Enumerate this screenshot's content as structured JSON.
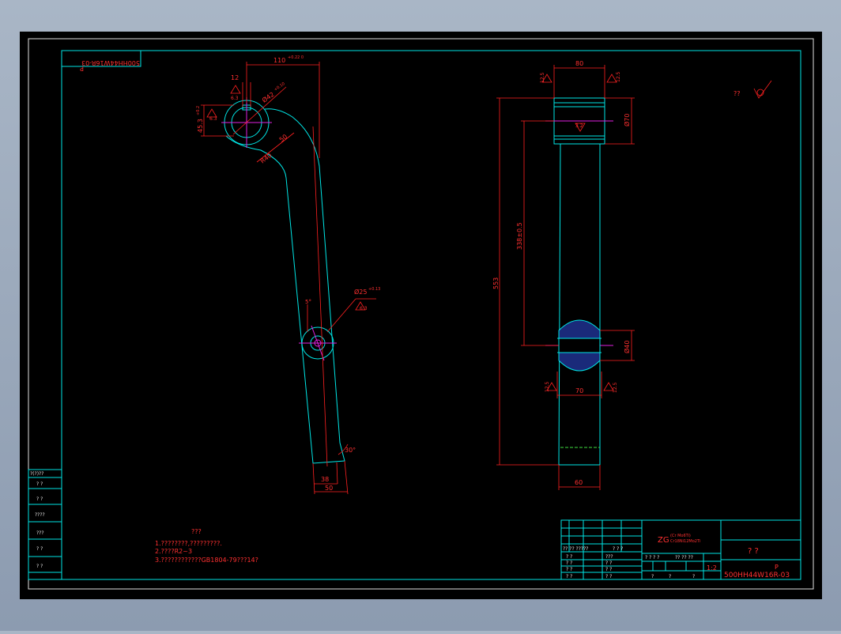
{
  "drawing": {
    "title_block": {
      "drawing_number": "500HH44W16R-03",
      "drawing_number_mirrored": "500HH44W16R-03",
      "sheet_mark": "P",
      "part_name": "?   ?",
      "scale": "1:2",
      "material_top": "ZG",
      "material_sub_1": "(Cr Mo6Ti)",
      "material_sub_2": "Cr18Ni12Mo2Ti",
      "cells_left": [
        "?? ?? ?????",
        "? ?",
        "? ?",
        "? ?",
        "? ?"
      ],
      "cells_mid": [
        "? ?  ?",
        "???",
        "? ?",
        "? ?",
        "? ?"
      ],
      "cells_right": [
        "? ? ? ?",
        "?? ??  ??",
        "?",
        "?",
        "?"
      ]
    },
    "surface_note": "??",
    "notes": {
      "heading": "???",
      "items": [
        "1.????????,?????????.",
        "2.????R2~3",
        "3.????????????GB1804-79???14?"
      ]
    },
    "side_table": [
      "?(?)??",
      "?  ?",
      "?  ?",
      "????",
      "???",
      "?  ?",
      "?  ?"
    ],
    "left_view_dims": {
      "width_top": "110",
      "width_top_tol": "+0.22\n0",
      "bore_dia": "Ø42",
      "bore_tol": "+0.10",
      "key_width": "12",
      "key_depth": "45.3",
      "key_depth_tol": "+0.2",
      "rough_1": "6.3",
      "rough_2": "6.3",
      "radius_40": "R40",
      "radius_50": "50",
      "pin_dia": "Ø25",
      "pin_tol": "+0.13",
      "rough_3": "6.3",
      "angle_5": "5°",
      "angle_30": "30°",
      "bottom_38": "38",
      "bottom_50": "50"
    },
    "right_view_dims": {
      "top_80": "80",
      "dia_70": "Ø70",
      "len_553": "553",
      "len_338": "338±0.5",
      "dia_40": "Ø40",
      "w_70": "70",
      "w_60": "60",
      "rough_a": "12.5",
      "rough_b": "12.5",
      "rough_c": "3.2",
      "rough_d": "12.5",
      "rough_e": "12.5"
    }
  }
}
